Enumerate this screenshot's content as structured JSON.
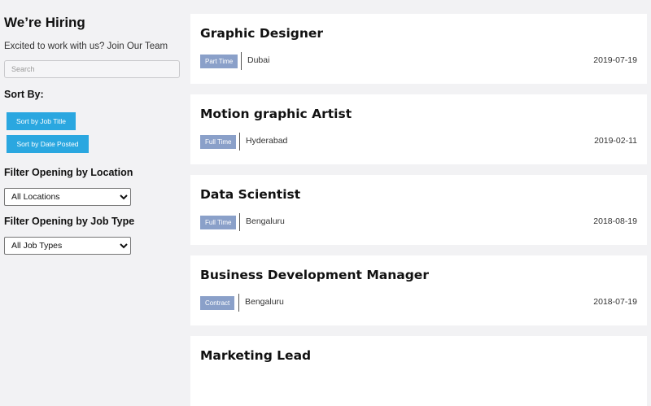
{
  "sidebar": {
    "title": "We’re Hiring",
    "subtitle": "Excited to work with us? Join Our Team",
    "search_placeholder": "Search",
    "sort_title": "Sort By:",
    "sort_by_title_label": "Sort by Job Title",
    "sort_by_date_label": "Sort by Date Posted",
    "filter_location_label": "Filter Opening by Location",
    "location_selected": "All Locations",
    "filter_type_label": "Filter Opening by Job Type",
    "type_selected": "All Job Types"
  },
  "jobs": [
    {
      "title": "Graphic Designer",
      "type": "Part Time",
      "location": "Dubai",
      "date": "2019-07-19"
    },
    {
      "title": "Motion graphic Artist",
      "type": "Full Time",
      "location": "Hyderabad",
      "date": "2019-02-11"
    },
    {
      "title": "Data Scientist",
      "type": "Full Time",
      "location": "Bengaluru",
      "date": "2018-08-19"
    },
    {
      "title": "Business Development Manager",
      "type": "Contract",
      "location": "Bengaluru",
      "date": "2018-07-19"
    },
    {
      "title": "Marketing Lead",
      "type": "",
      "location": "",
      "date": ""
    }
  ],
  "colors": {
    "accent": "#2aa7e0",
    "badge": "#8aa0c9",
    "background": "#f2f2f4"
  }
}
